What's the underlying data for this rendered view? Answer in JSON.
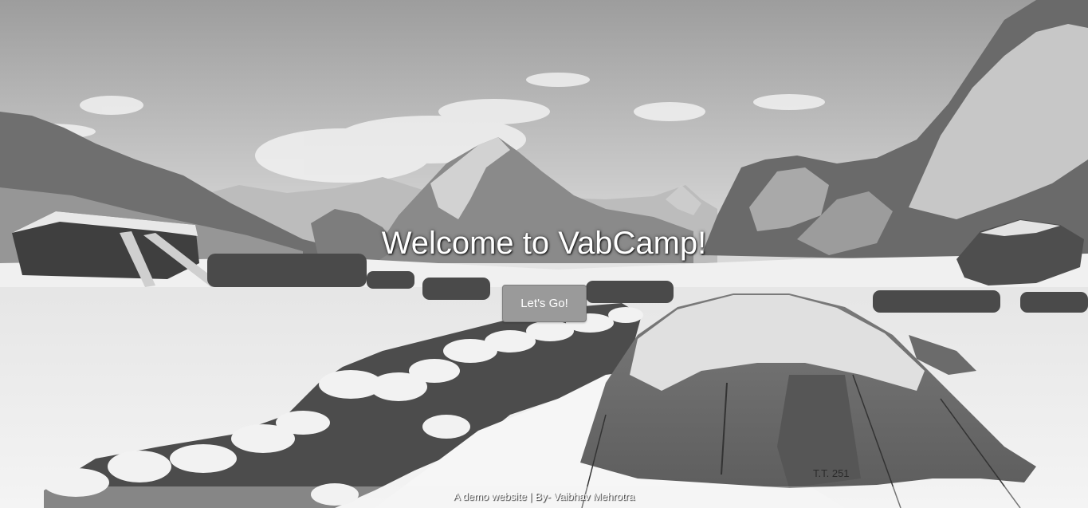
{
  "hero": {
    "title": "Welcome to VabCamp!",
    "cta_label": "Let's Go!",
    "tent_tag": "T.T. 251"
  },
  "footer": {
    "credit": "A demo website | By- Vaibhav Mehrotra"
  },
  "colors": {
    "title_text": "#ffffff",
    "button_background": "#9a9a9a",
    "footer_text": "#ffffff"
  }
}
